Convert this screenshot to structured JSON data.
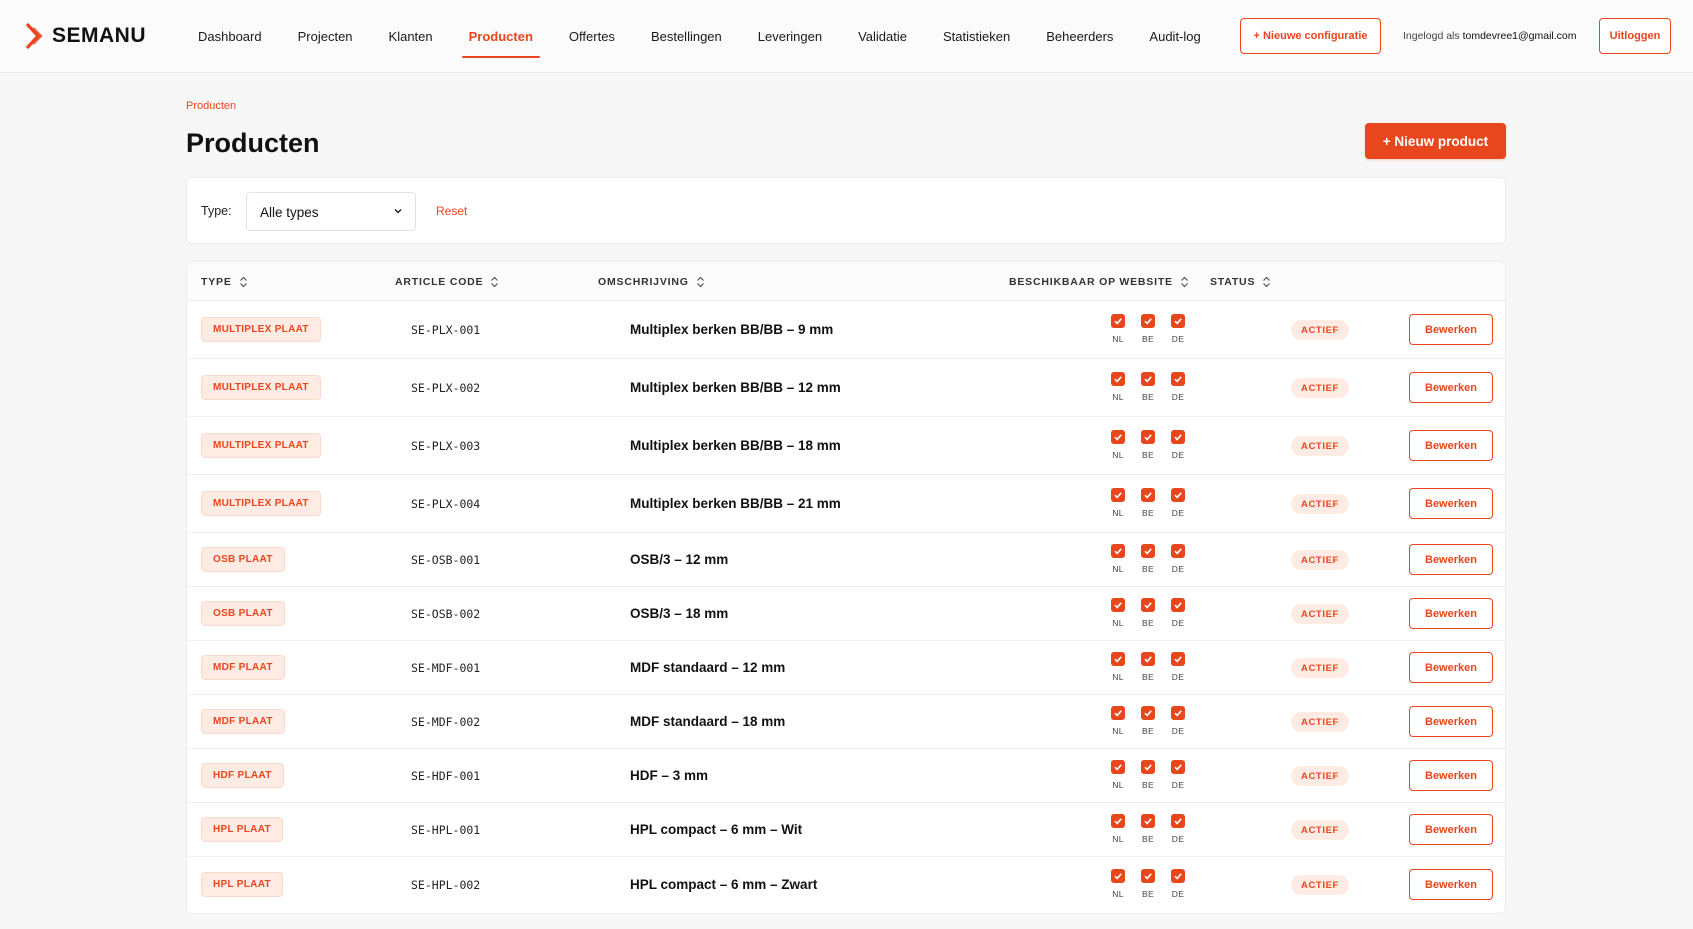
{
  "brand": {
    "name": "SEMANU",
    "accent": "#e8461d"
  },
  "nav": {
    "items": [
      "Dashboard",
      "Projecten",
      "Klanten",
      "Producten",
      "Offertes",
      "Bestellingen",
      "Leveringen",
      "Validatie",
      "Statistieken",
      "Beheerders",
      "Audit-log"
    ],
    "active": "Producten"
  },
  "header": {
    "new_config_label": "+ Nieuwe configuratie",
    "logged_in_prefix": "Ingelogd als",
    "user_email": "tomdevree1@gmail.com",
    "logout_label": "Uitloggen"
  },
  "page": {
    "breadcrumb": "Producten",
    "title": "Producten",
    "new_product_label": "+ Nieuw product"
  },
  "filter": {
    "type_label": "Type:",
    "type_value": "Alle types",
    "reset_label": "Reset"
  },
  "table": {
    "columns": [
      "TYPE",
      "ARTICLE CODE",
      "OMSCHRIJVING",
      "BESCHIKBAAR OP WEBSITE",
      "STATUS"
    ],
    "country_labels": [
      "NL",
      "BE",
      "DE"
    ],
    "edit_label": "Bewerken",
    "rows": [
      {
        "type": "MULTIPLEX PLAAT",
        "code": "SE-PLX-001",
        "description": "Multiplex berken BB/BB – 9 mm",
        "available": [
          true,
          true,
          true
        ],
        "status": "ACTIEF"
      },
      {
        "type": "MULTIPLEX PLAAT",
        "code": "SE-PLX-002",
        "description": "Multiplex berken BB/BB – 12 mm",
        "available": [
          true,
          true,
          true
        ],
        "status": "ACTIEF"
      },
      {
        "type": "MULTIPLEX PLAAT",
        "code": "SE-PLX-003",
        "description": "Multiplex berken BB/BB – 18 mm",
        "available": [
          true,
          true,
          true
        ],
        "status": "ACTIEF"
      },
      {
        "type": "MULTIPLEX PLAAT",
        "code": "SE-PLX-004",
        "description": "Multiplex berken BB/BB – 21 mm",
        "available": [
          true,
          true,
          true
        ],
        "status": "ACTIEF"
      },
      {
        "type": "OSB PLAAT",
        "code": "SE-OSB-001",
        "description": "OSB/3 – 12 mm",
        "available": [
          true,
          true,
          true
        ],
        "status": "ACTIEF"
      },
      {
        "type": "OSB PLAAT",
        "code": "SE-OSB-002",
        "description": "OSB/3 – 18 mm",
        "available": [
          true,
          true,
          true
        ],
        "status": "ACTIEF"
      },
      {
        "type": "MDF PLAAT",
        "code": "SE-MDF-001",
        "description": "MDF standaard – 12 mm",
        "available": [
          true,
          true,
          true
        ],
        "status": "ACTIEF"
      },
      {
        "type": "MDF PLAAT",
        "code": "SE-MDF-002",
        "description": "MDF standaard – 18 mm",
        "available": [
          true,
          true,
          true
        ],
        "status": "ACTIEF"
      },
      {
        "type": "HDF PLAAT",
        "code": "SE-HDF-001",
        "description": "HDF – 3 mm",
        "available": [
          true,
          true,
          true
        ],
        "status": "ACTIEF"
      },
      {
        "type": "HPL PLAAT",
        "code": "SE-HPL-001",
        "description": "HPL compact – 6 mm – Wit",
        "available": [
          true,
          true,
          true
        ],
        "status": "ACTIEF"
      },
      {
        "type": "HPL PLAAT",
        "code": "SE-HPL-002",
        "description": "HPL compact – 6 mm – Zwart",
        "available": [
          true,
          true,
          true
        ],
        "status": "ACTIEF"
      }
    ]
  }
}
